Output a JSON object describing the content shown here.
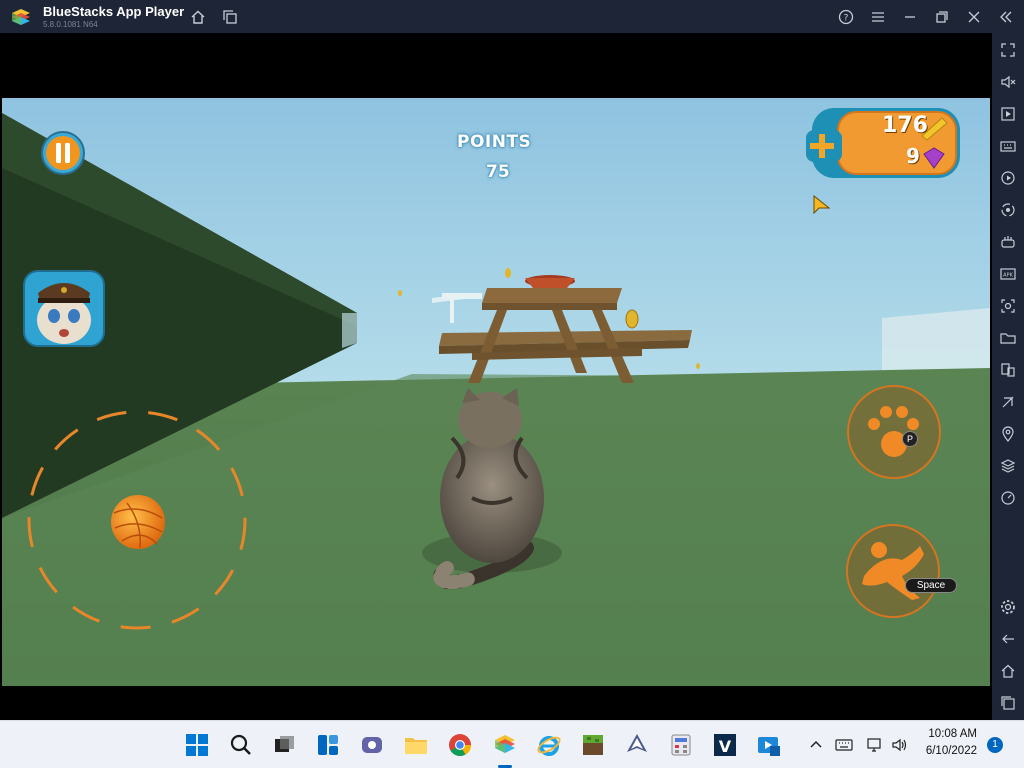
{
  "window": {
    "title": "BlueStacks App Player",
    "version": "5.8.0.1081 N64"
  },
  "titlebar_buttons": [
    "home-icon",
    "multi-instance-icon",
    "help-icon",
    "menu-icon",
    "minimize-icon",
    "restore-icon",
    "close-icon",
    "collapse-sidebar-icon"
  ],
  "sidebar_items": [
    "fullscreen-icon",
    "volume-mute-icon",
    "media-manager-icon",
    "keyboard-controls-icon",
    "macro-recorder-icon",
    "sync-instances-icon",
    "game-controls-icon",
    "install-apk-icon",
    "screenshot-icon",
    "folder-icon",
    "multi-instance-sidebar-icon",
    "eco-mode-icon",
    "location-icon",
    "layers-icon",
    "performance-icon",
    "settings-icon",
    "back-icon",
    "home-sidebar-icon",
    "recent-apps-icon"
  ],
  "game": {
    "points_label": "POINTS",
    "points_value": "75",
    "coins": "176",
    "gems": "9",
    "jump_key": "Space",
    "paw_key": "P"
  },
  "taskbar": {
    "apps": [
      "windows-start-icon",
      "search-icon",
      "task-view-icon",
      "widgets-icon",
      "teams-chat-icon",
      "file-explorer-icon",
      "chrome-icon",
      "bluestacks-icon",
      "internet-explorer-icon",
      "minecraft-icon",
      "inkscape-icon",
      "calculator-app-icon",
      "vscode-icon",
      "media-player-icon"
    ],
    "time": "10:08 AM",
    "date": "6/10/2022",
    "notifications": "1"
  },
  "colors": {
    "titlebar": "#1e2536",
    "sky": "#9dcbe3",
    "grass": "#4f7a47",
    "accent": "#0067c0"
  }
}
